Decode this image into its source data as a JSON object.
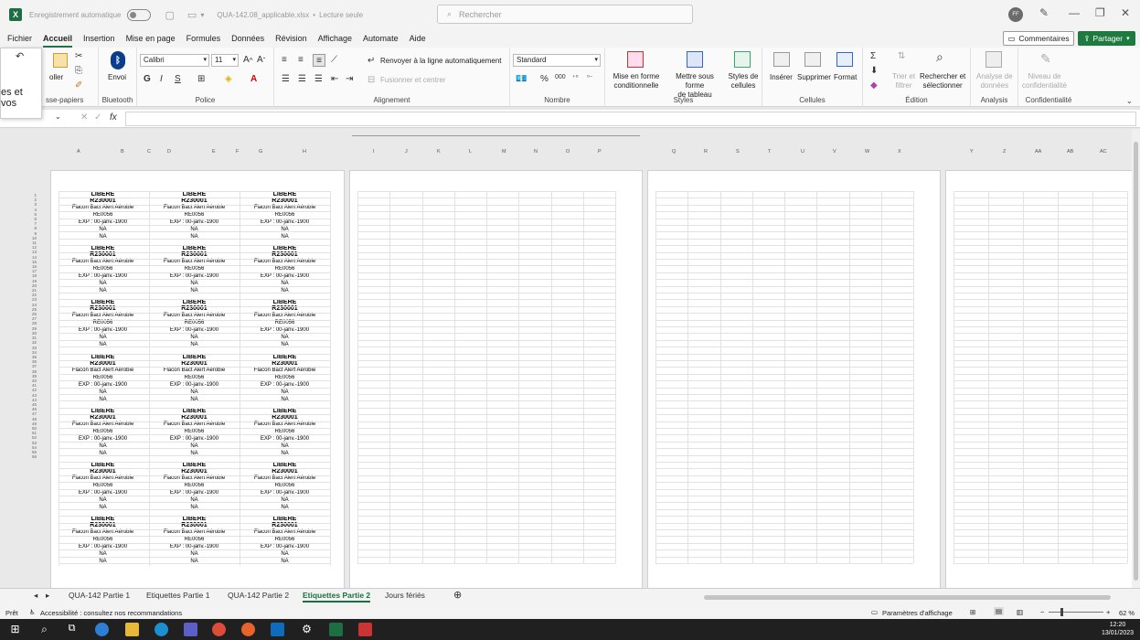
{
  "titlebar": {
    "autosave": "Enregistrement automatique",
    "filename": "QUA-142.08_applicable.xlsx",
    "separator": "•",
    "mode": "Lecture seule",
    "search_placeholder": "Rechercher",
    "avatar": "FF"
  },
  "ribbon_tabs": [
    "Fichier",
    "Accueil",
    "Insertion",
    "Mise en page",
    "Formules",
    "Données",
    "Révision",
    "Affichage",
    "Automate",
    "Aide"
  ],
  "comments_label": "Commentaires",
  "share_label": "Partager",
  "popover_text": "es et vos",
  "ribbon": {
    "clipboard_paste": "oller",
    "clipboard_group": "sse-papiers",
    "bluetooth_btn": "Envoi",
    "bluetooth_group": "Bluetooth",
    "font_name": "Calibri",
    "font_size": "11",
    "bold": "G",
    "italic": "I",
    "underline": "S",
    "font_group": "Police",
    "wrap": "Renvoyer à la ligne automatiquement",
    "merge": "Fusionner et centrer",
    "align_group": "Alignement",
    "number_format": "Standard",
    "number_group": "Nombre",
    "cond_format": "Mise en forme",
    "cond_format2": "conditionnelle",
    "table_format": "Mettre sous forme",
    "table_format2": "de tableau",
    "cell_styles": "Styles de",
    "cell_styles2": "cellules",
    "styles_group": "Styles",
    "insert": "Insérer",
    "delete": "Supprimer",
    "format": "Format",
    "cells_group": "Cellules",
    "sort": "Trier et",
    "sort2": "filtrer",
    "find": "Rechercher et",
    "find2": "sélectionner",
    "edit_group": "Édition",
    "analyze": "Analyse de",
    "analyze2": "données",
    "analysis_group": "Analysis",
    "sensitivity": "Niveau de",
    "sensitivity2": "confidentialité",
    "conf_group": "Confidentialité"
  },
  "column_headers": [
    "A",
    "B",
    "C",
    "D",
    "E",
    "F",
    "G",
    "H",
    "I",
    "J",
    "K",
    "L",
    "M",
    "N",
    "O",
    "P",
    "Q",
    "R",
    "S",
    "T",
    "U",
    "V",
    "W",
    "X",
    "Y",
    "Z",
    "AA",
    "AB",
    "AC"
  ],
  "label": {
    "l1": "LIBERE",
    "l2": "R230001",
    "l3": "Flacon Bact Alert Aérobie",
    "l4": "RE0056",
    "l5": "EXP : 00-janv.-1900",
    "l6": "NA",
    "l7": "NA"
  },
  "sheet_tabs": [
    "QUA-142 Partie 1",
    "Etiquettes Partie 1",
    "QUA-142 Partie 2",
    "Etiquettes Partie 2",
    "Jours fériés"
  ],
  "active_sheet": "Etiquettes Partie 2",
  "status": {
    "ready": "Prêt",
    "accessibility": "Accessibilité : consultez nos recommandations",
    "display_settings": "Paramètres d'affichage",
    "zoom": "62 %"
  },
  "clock": {
    "time": "12:20",
    "date": "13/01/2023"
  }
}
